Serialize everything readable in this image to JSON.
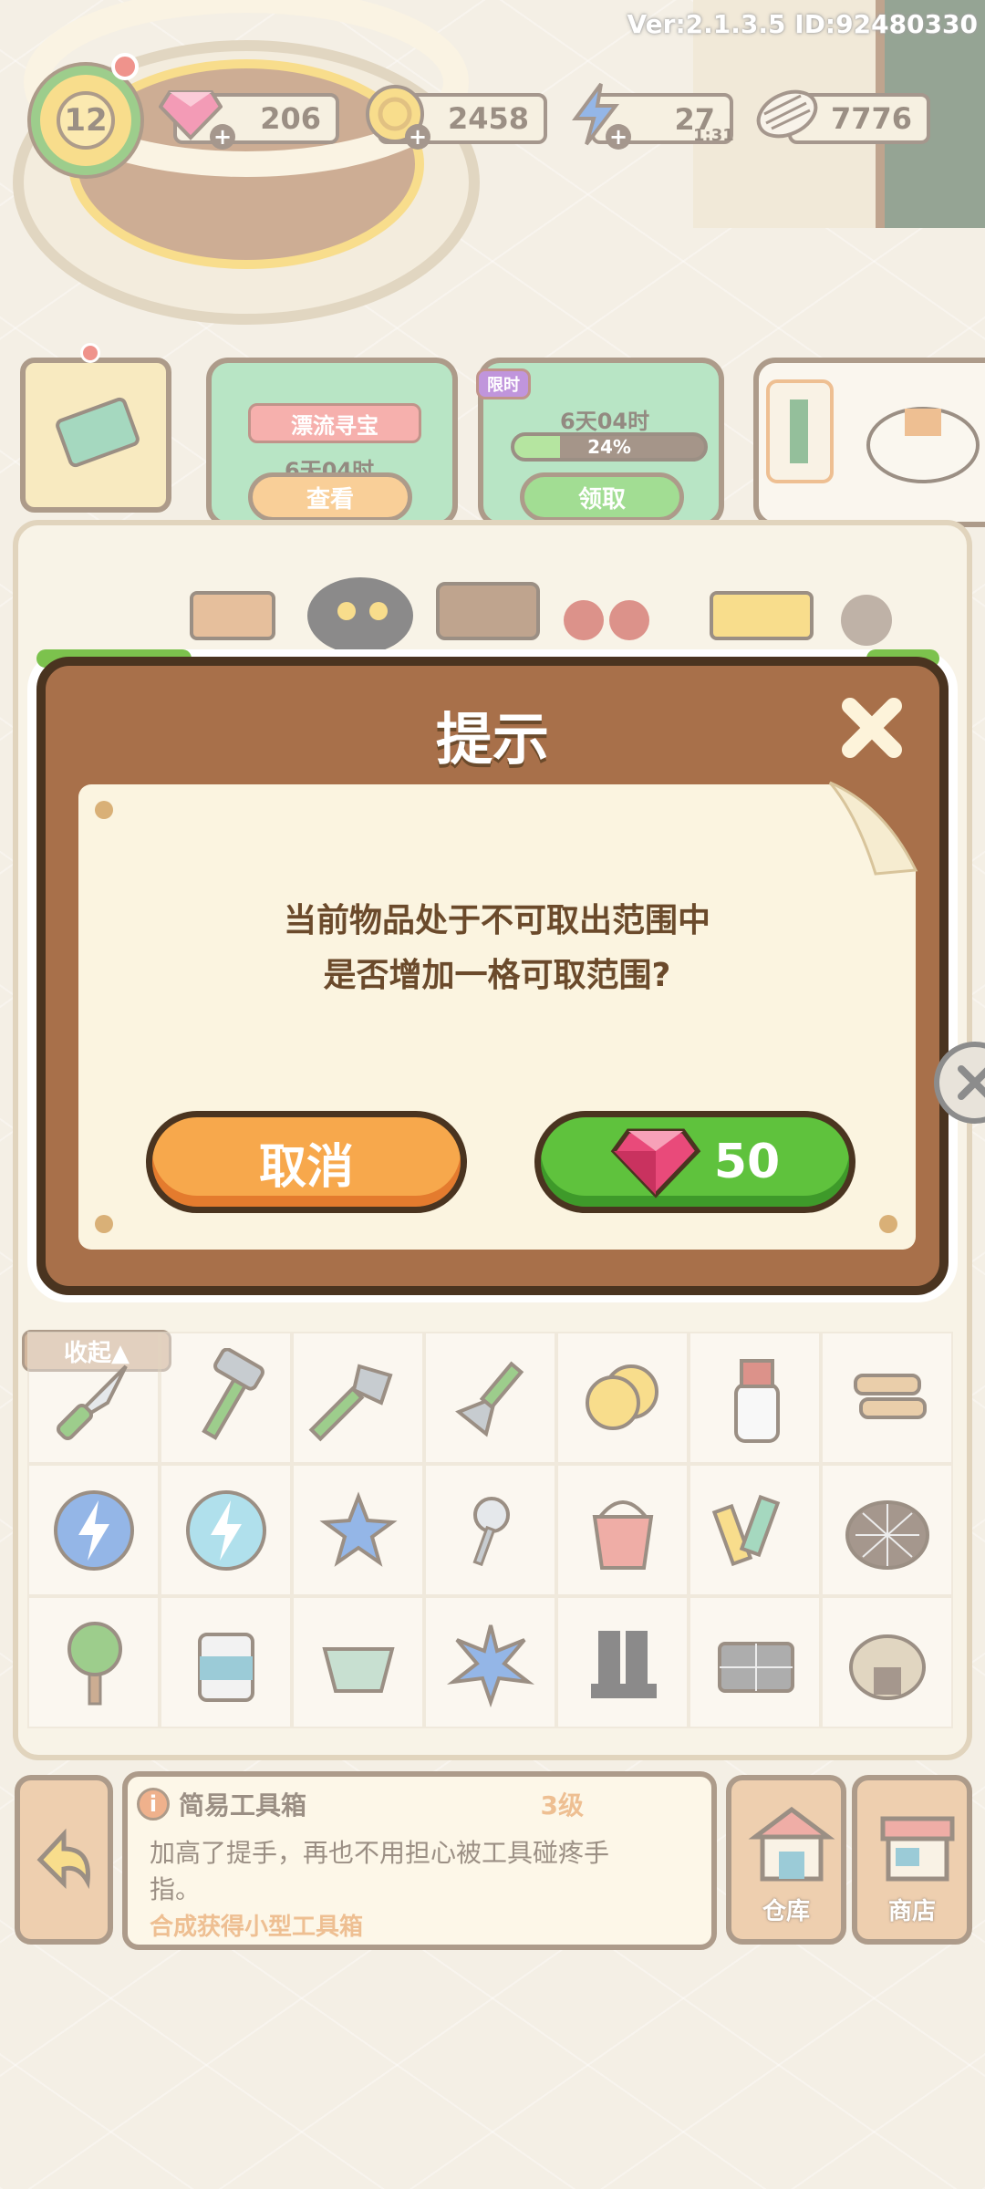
{
  "hud": {
    "version": "Ver:2.1.3.5 ID:92480330",
    "level": "12",
    "gems": "206",
    "coins": "2458",
    "energy": "27",
    "energy_timer": "1:31",
    "seeds": "7776"
  },
  "events": {
    "drift_treasure": {
      "banner": "漂流寻宝",
      "time": "6天04时",
      "button": "查看"
    },
    "fountain": {
      "badge": "限时",
      "time": "6天04时",
      "progress_text": "24%",
      "progress": 0.24,
      "button": "领取"
    }
  },
  "board": {
    "collapse_label": "收起▲"
  },
  "item_info": {
    "name": "简易工具箱",
    "level": "3级",
    "description": "加高了提手，再也不用担心被工具碰疼手指。",
    "hint": "合成获得小型工具箱"
  },
  "nav": {
    "warehouse_label": "仓库",
    "shop_label": "商店"
  },
  "dialog": {
    "title": "提示",
    "message_line1": "当前物品处于不可取出范围中",
    "message_line2": "是否增加一格可取范围?",
    "cancel_label": "取消",
    "buy_price": "50"
  },
  "colors": {
    "dialog_wood": "#a8704a",
    "dialog_paper": "#fbf4e0",
    "cancel_orange": "#f7a84c",
    "buy_green": "#5fc23d",
    "gem_pink": "#e94a7a",
    "outline_brown": "#4a3420"
  },
  "icons": {
    "gem": "gem-icon",
    "coin": "coin-icon",
    "energy": "lightning-icon",
    "seed": "seed-icon",
    "close": "close-icon",
    "back": "back-arrow-icon",
    "warehouse": "warehouse-icon",
    "shop": "shop-icon"
  }
}
